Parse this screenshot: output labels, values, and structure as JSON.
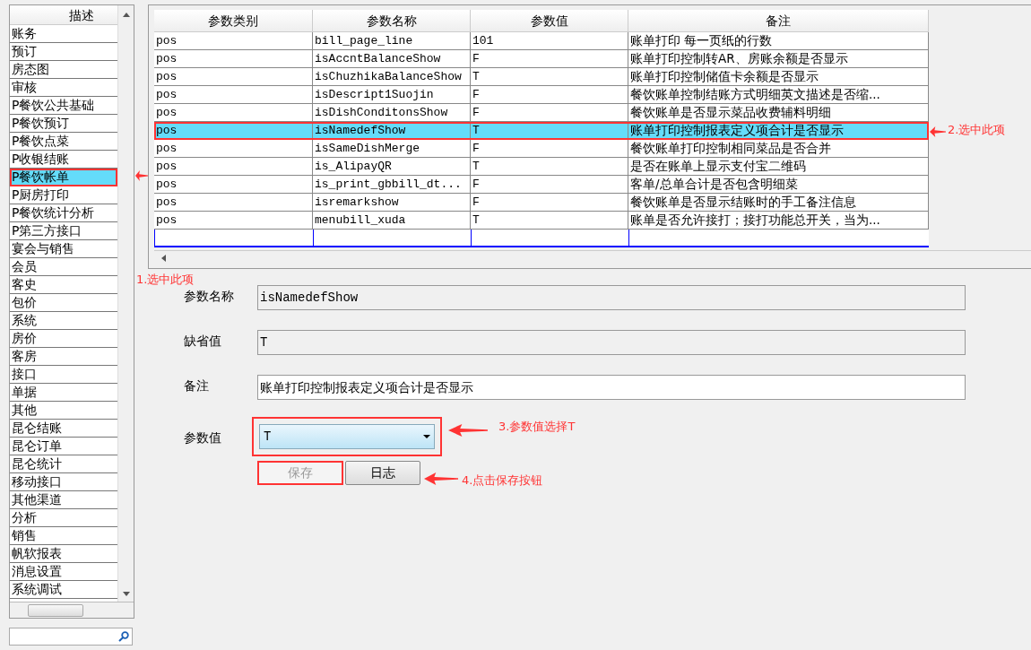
{
  "sidebar": {
    "header": "描述",
    "items": [
      {
        "label": "账务",
        "selected": false
      },
      {
        "label": "预订",
        "selected": false
      },
      {
        "label": "房态图",
        "selected": false
      },
      {
        "label": "审核",
        "selected": false
      },
      {
        "label": "P餐饮公共基础",
        "selected": false
      },
      {
        "label": "P餐饮预订",
        "selected": false
      },
      {
        "label": "P餐饮点菜",
        "selected": false
      },
      {
        "label": "P收银结账",
        "selected": false
      },
      {
        "label": "P餐饮帐单",
        "selected": true
      },
      {
        "label": "P厨房打印",
        "selected": false
      },
      {
        "label": "P餐饮统计分析",
        "selected": false
      },
      {
        "label": "P第三方接口",
        "selected": false
      },
      {
        "label": "宴会与销售",
        "selected": false
      },
      {
        "label": "会员",
        "selected": false
      },
      {
        "label": "客史",
        "selected": false
      },
      {
        "label": "包价",
        "selected": false
      },
      {
        "label": "系统",
        "selected": false
      },
      {
        "label": "房价",
        "selected": false
      },
      {
        "label": "客房",
        "selected": false
      },
      {
        "label": "接口",
        "selected": false
      },
      {
        "label": "单据",
        "selected": false
      },
      {
        "label": "其他",
        "selected": false
      },
      {
        "label": "昆仑结账",
        "selected": false
      },
      {
        "label": "昆仑订单",
        "selected": false
      },
      {
        "label": "昆仑统计",
        "selected": false
      },
      {
        "label": "移动接口",
        "selected": false
      },
      {
        "label": "其他渠道",
        "selected": false
      },
      {
        "label": "分析",
        "selected": false
      },
      {
        "label": "销售",
        "selected": false
      },
      {
        "label": "帆软报表",
        "selected": false
      },
      {
        "label": "消息设置",
        "selected": false
      },
      {
        "label": "系统调试",
        "selected": false
      }
    ]
  },
  "grid": {
    "columns": [
      "参数类别",
      "参数名称",
      "参数值",
      "备注"
    ],
    "rows": [
      {
        "category": "pos",
        "name": "bill_page_line",
        "value": "101",
        "note": "账单打印 每一页纸的行数",
        "selected": false
      },
      {
        "category": "pos",
        "name": "isAccntBalanceShow",
        "value": "F",
        "note": "账单打印控制转AR、房账余额是否显示",
        "selected": false
      },
      {
        "category": "pos",
        "name": "isChuzhikaBalanceShow",
        "value": "T",
        "note": "账单打印控制储值卡余额是否显示",
        "selected": false
      },
      {
        "category": "pos",
        "name": "isDescript1Suojin",
        "value": "F",
        "note": "餐饮账单控制结账方式明细英文描述是否缩...",
        "selected": false
      },
      {
        "category": "pos",
        "name": "isDishConditonsShow",
        "value": "F",
        "note": "餐饮账单是否显示菜品收费辅料明细",
        "selected": false
      },
      {
        "category": "pos",
        "name": "isNamedefShow",
        "value": "T",
        "note": "账单打印控制报表定义项合计是否显示",
        "selected": true
      },
      {
        "category": "pos",
        "name": "isSameDishMerge",
        "value": "F",
        "note": "餐饮账单打印控制相同菜品是否合并",
        "selected": false
      },
      {
        "category": "pos",
        "name": "is_AlipayQR",
        "value": "T",
        "note": "是否在账单上显示支付宝二维码",
        "selected": false
      },
      {
        "category": "pos",
        "name": "is_print_gbbill_dt...",
        "value": "F",
        "note": "客单/总单合计是否包含明细菜",
        "selected": false
      },
      {
        "category": "pos",
        "name": "isremarkshow",
        "value": "F",
        "note": "餐饮账单是否显示结账时的手工备注信息",
        "selected": false
      },
      {
        "category": "pos",
        "name": "menubill_xuda",
        "value": "T",
        "note": "账单是否允许接打；接打功能总开关，当为...",
        "selected": false
      }
    ]
  },
  "form": {
    "fields": [
      {
        "kind": "readonly",
        "label": "参数名称",
        "value": "isNamedefShow"
      },
      {
        "kind": "readonly",
        "label": "缺省值",
        "value": "T"
      },
      {
        "kind": "text",
        "label": "备注",
        "value": "账单打印控制报表定义项合计是否显示"
      },
      {
        "kind": "select",
        "label": "参数值",
        "value": "T"
      }
    ],
    "buttons": [
      {
        "label": "保存",
        "disabled": true
      },
      {
        "label": "日志",
        "disabled": false
      }
    ]
  },
  "annotations": [
    {
      "kind": "sidebar",
      "label": "1.选中此项"
    },
    {
      "kind": "grid",
      "label": "2.选中此项"
    },
    {
      "kind": "select",
      "label": "3.参数值选择T"
    },
    {
      "kind": "save",
      "label": "4.点击保存按钮"
    }
  ]
}
